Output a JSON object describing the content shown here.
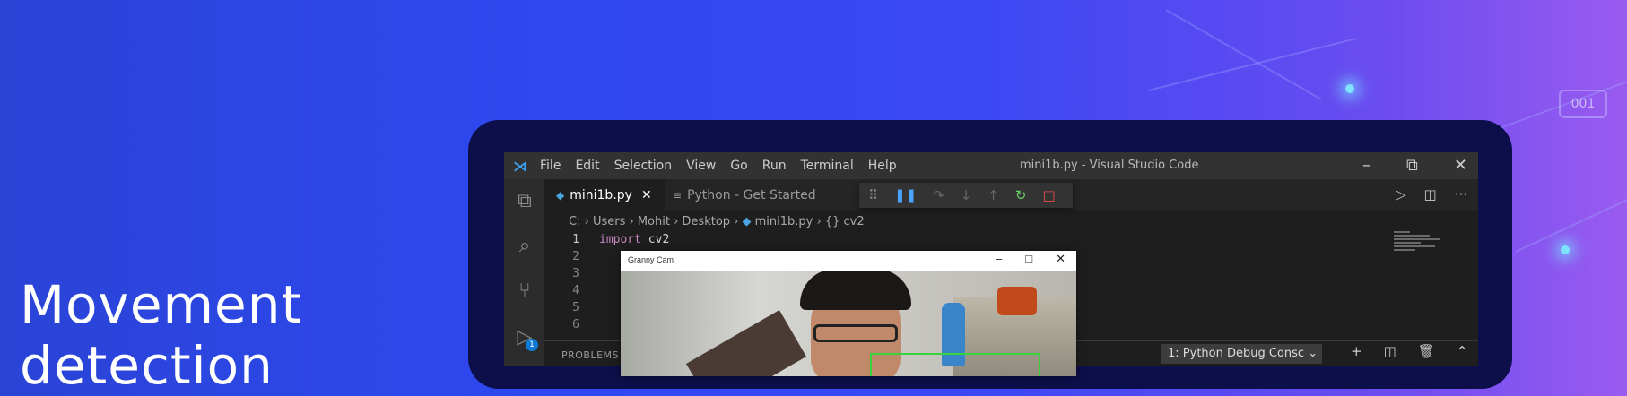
{
  "headline": {
    "line1": "Movement",
    "line2": "detection"
  },
  "decor": {
    "badge": "001"
  },
  "vscode": {
    "window_title": "mini1b.py - Visual Studio Code",
    "menu": [
      "File",
      "Edit",
      "Selection",
      "View",
      "Go",
      "Run",
      "Terminal",
      "Help"
    ],
    "tabs": [
      {
        "label": "mini1b.py",
        "active": true
      },
      {
        "label": "Python - Get Started",
        "active": false
      }
    ],
    "breadcrumb": [
      "C:",
      "Users",
      "Mohit",
      "Desktop",
      "mini1b.py",
      "{} cv2"
    ],
    "code_lines": [
      {
        "n": "1",
        "kw": "import",
        "rest": " cv2"
      },
      {
        "n": "2",
        "kw": "",
        "rest": ""
      },
      {
        "n": "3",
        "kw": "",
        "rest": ""
      },
      {
        "n": "4",
        "kw": "",
        "rest": ""
      },
      {
        "n": "5",
        "kw": "",
        "rest": ""
      },
      {
        "n": "6",
        "kw": "",
        "rest": ""
      }
    ],
    "activity_badge": "1",
    "panel": {
      "label": "PROBLEMS",
      "terminal_select": "1: Python Debug Consc"
    }
  },
  "cam_window": {
    "title": "Granny Cam"
  },
  "colors": {
    "accent_blue": "#0e7ad8",
    "detection_box": "#3bd33b",
    "keyword": "#c586c0"
  }
}
